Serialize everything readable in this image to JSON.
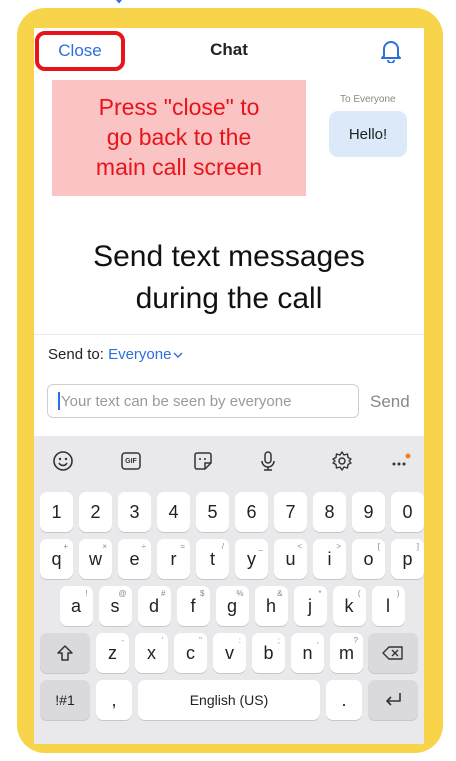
{
  "header": {
    "close_label": "Close",
    "title": "Chat"
  },
  "annotation": {
    "line1": "Press \"close\" to",
    "line2": "go back to the",
    "line3": "main call screen"
  },
  "message": {
    "recipient_label": "To Everyone",
    "text": "Hello!"
  },
  "caption": {
    "line1": "Send text messages",
    "line2": "during the call"
  },
  "send_to": {
    "label": "Send to:",
    "target": "Everyone"
  },
  "composer": {
    "placeholder": "Your text can be seen by everyone",
    "send_label": "Send"
  },
  "keyboard": {
    "toolbar_icons": [
      "emoji-icon",
      "gif-icon",
      "sticker-icon",
      "microphone-icon",
      "settings-icon",
      "more-icon"
    ],
    "gif_label": "GIF",
    "number_row": [
      "1",
      "2",
      "3",
      "4",
      "5",
      "6",
      "7",
      "8",
      "9",
      "0"
    ],
    "row_q": [
      [
        "q",
        "+"
      ],
      [
        "w",
        "×"
      ],
      [
        "e",
        "÷"
      ],
      [
        "r",
        "="
      ],
      [
        "t",
        "/"
      ],
      [
        "y",
        "_"
      ],
      [
        "u",
        "<"
      ],
      [
        "i",
        ">"
      ],
      [
        "o",
        "["
      ],
      [
        "p",
        "]"
      ]
    ],
    "row_a": [
      [
        "a",
        "!"
      ],
      [
        "s",
        "@"
      ],
      [
        "d",
        "#"
      ],
      [
        "f",
        "$"
      ],
      [
        "g",
        "%"
      ],
      [
        "h",
        "&"
      ],
      [
        "j",
        "*"
      ],
      [
        "k",
        "("
      ],
      [
        "l",
        ")"
      ]
    ],
    "row_z": [
      [
        "z",
        "-"
      ],
      [
        "x",
        "'"
      ],
      [
        "c",
        "\""
      ],
      [
        "v",
        ":"
      ],
      [
        "b",
        ";"
      ],
      [
        "n",
        ","
      ],
      [
        "m",
        "?"
      ]
    ],
    "symbols_label": "!#1",
    "comma_label": ",",
    "space_label": "English (US)",
    "period_label": ".",
    "accent_dot_color": "#f07f2a"
  }
}
